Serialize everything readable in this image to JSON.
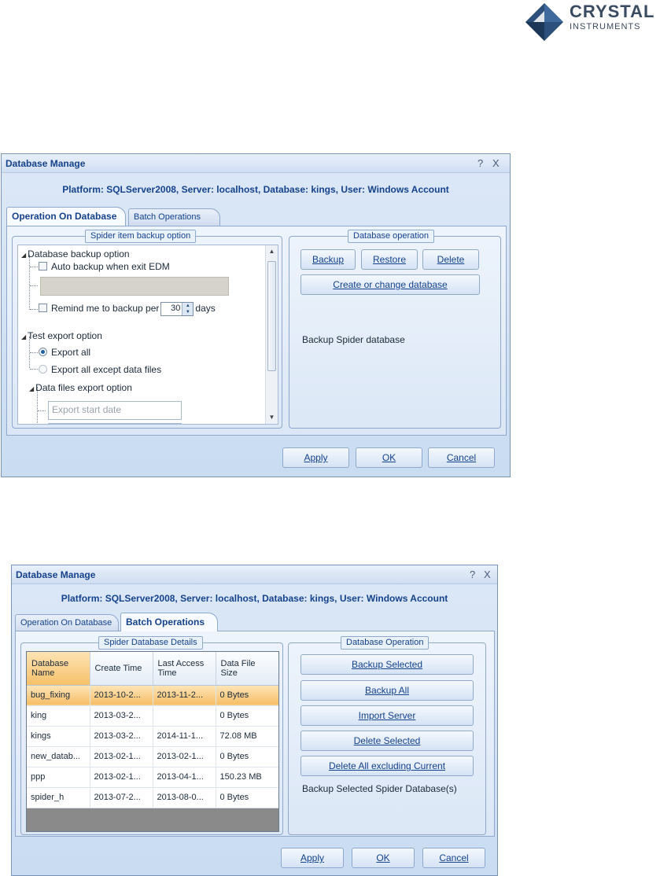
{
  "logo": {
    "line1": "CRYSTAL",
    "line2": "INSTRUMENTS"
  },
  "dialog1": {
    "title": "Database Manage",
    "help": "?",
    "close": "X",
    "platform": "Platform: SQLServer2008, Server: localhost, Database: kings, User: Windows Account",
    "tabs": [
      "Operation On Database",
      "Batch Operations"
    ],
    "active_tab": "Operation On Database",
    "left_group": "Spider item backup option",
    "tree": {
      "db_backup": "Database backup option",
      "auto_backup": "Auto backup when exit EDM",
      "remind_prefix": "Remind me to backup per",
      "remind_value": "30",
      "remind_suffix": "days",
      "test_export": "Test export option",
      "export_all": "Export all",
      "export_except": "Export all except data files",
      "data_files": "Data files export option",
      "start_date_placeholder": "Export start date"
    },
    "right_group": "Database operation",
    "buttons": {
      "backup": "Backup",
      "restore": "Restore",
      "delete": "Delete",
      "create": "Create or change database"
    },
    "status": "Backup Spider database",
    "footer": {
      "apply": "Apply",
      "ok": "OK",
      "cancel": "Cancel"
    }
  },
  "dialog2": {
    "title": "Database Manage",
    "help": "?",
    "close": "X",
    "platform": "Platform: SQLServer2008, Server: localhost, Database: kings, User: Windows Account",
    "tabs": [
      "Operation On Database",
      "Batch Operations"
    ],
    "active_tab": "Batch Operations",
    "left_group": "Spider Database Details",
    "columns": [
      "Database Name",
      "Create Time",
      "Last Access Time",
      "Data File Size"
    ],
    "rows": [
      [
        "bug_fixing",
        "2013-10-2...",
        "2013-11-2...",
        "0 Bytes"
      ],
      [
        "king",
        "2013-03-2...",
        "",
        "0 Bytes"
      ],
      [
        "kings",
        "2013-03-2...",
        "2014-11-1...",
        "72.08 MB"
      ],
      [
        "new_datab...",
        "2013-02-1...",
        "2013-02-1...",
        "0 Bytes"
      ],
      [
        "ppp",
        "2013-02-1...",
        "2013-04-1...",
        "150.23 MB"
      ],
      [
        "spider_h",
        "2013-07-2...",
        "2013-08-0...",
        "0 Bytes"
      ]
    ],
    "right_group": "Database Operation",
    "buttons": {
      "backup_selected": "Backup Selected",
      "backup_all": "Backup All",
      "import_server": "Import Server",
      "delete_selected": "Delete Selected",
      "delete_all": "Delete All excluding Current"
    },
    "status": "Backup Selected Spider Database(s)",
    "footer": {
      "apply": "Apply",
      "ok": "OK",
      "cancel": "Cancel"
    }
  },
  "colors": {
    "title_blue": "#15428b",
    "selection_orange": "#f6c16a",
    "dialog_bg": "#c9dcf2"
  }
}
